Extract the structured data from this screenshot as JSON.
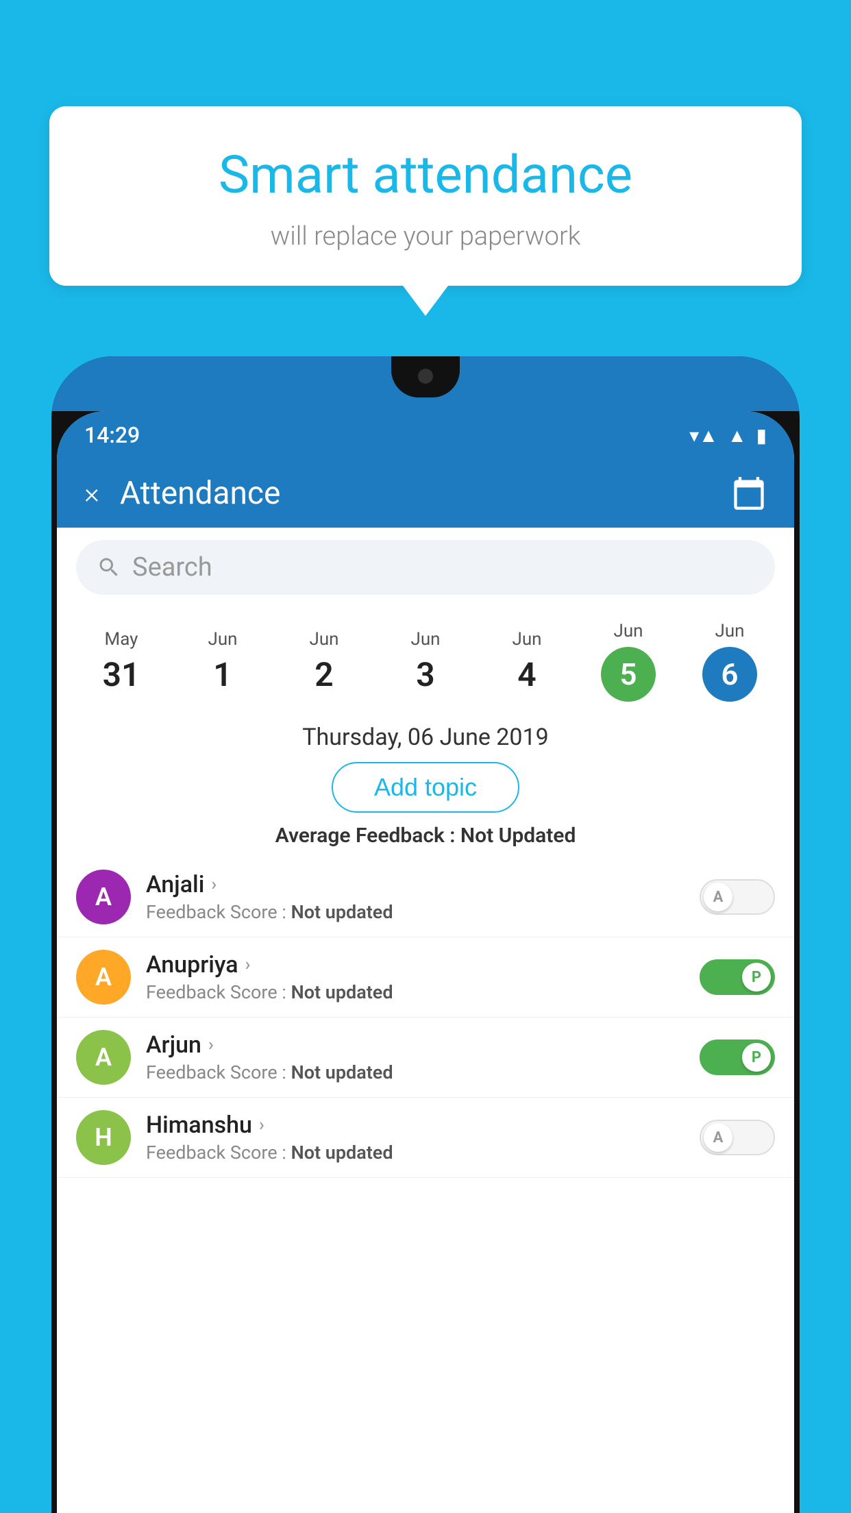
{
  "background_color": "#1ab8e8",
  "speech_bubble": {
    "title": "Smart attendance",
    "subtitle": "will replace your paperwork"
  },
  "status_bar": {
    "time": "14:29",
    "wifi_icon": "wifi",
    "signal_icon": "signal",
    "battery_icon": "battery"
  },
  "header": {
    "title": "Attendance",
    "close_label": "×",
    "calendar_icon": "calendar-icon"
  },
  "search": {
    "placeholder": "Search"
  },
  "calendar": {
    "dates": [
      {
        "month": "May",
        "day": "31",
        "type": "normal"
      },
      {
        "month": "Jun",
        "day": "1",
        "type": "normal"
      },
      {
        "month": "Jun",
        "day": "2",
        "type": "normal"
      },
      {
        "month": "Jun",
        "day": "3",
        "type": "normal"
      },
      {
        "month": "Jun",
        "day": "4",
        "type": "normal"
      },
      {
        "month": "Jun",
        "day": "5",
        "type": "today"
      },
      {
        "month": "Jun",
        "day": "6",
        "type": "selected"
      }
    ]
  },
  "selected_date_label": "Thursday, 06 June 2019",
  "add_topic_label": "Add topic",
  "avg_feedback_label": "Average Feedback :",
  "avg_feedback_value": "Not Updated",
  "students": [
    {
      "name": "Anjali",
      "avatar_letter": "A",
      "avatar_color": "#9c27b0",
      "feedback_label": "Feedback Score :",
      "feedback_value": "Not updated",
      "toggle_state": "off",
      "toggle_letter": "A"
    },
    {
      "name": "Anupriya",
      "avatar_letter": "A",
      "avatar_color": "#ffa726",
      "feedback_label": "Feedback Score :",
      "feedback_value": "Not updated",
      "toggle_state": "on",
      "toggle_letter": "P"
    },
    {
      "name": "Arjun",
      "avatar_letter": "A",
      "avatar_color": "#8bc34a",
      "feedback_label": "Feedback Score :",
      "feedback_value": "Not updated",
      "toggle_state": "on",
      "toggle_letter": "P"
    },
    {
      "name": "Himanshu",
      "avatar_letter": "H",
      "avatar_color": "#8bc34a",
      "feedback_label": "Feedback Score :",
      "feedback_value": "Not updated",
      "toggle_state": "off",
      "toggle_letter": "A"
    }
  ]
}
